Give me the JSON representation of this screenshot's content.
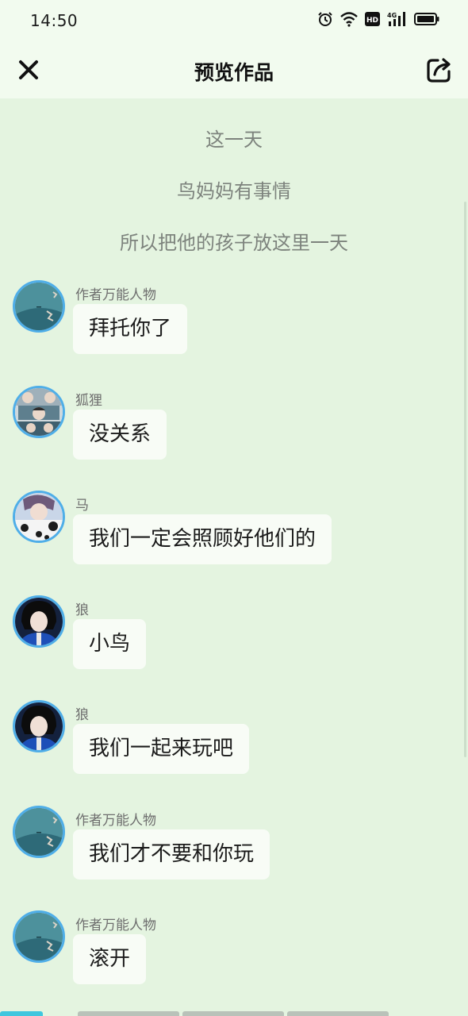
{
  "status": {
    "time": "14:50",
    "icons": [
      "alarm-icon",
      "wifi-icon",
      "hd-icon",
      "signal-4g-icon",
      "battery-icon"
    ],
    "hd_label": "HD",
    "network_label": "4G"
  },
  "nav": {
    "title": "预览作品",
    "close_icon": "close-icon",
    "share_icon": "share-icon"
  },
  "story": {
    "narration": [
      "这一天",
      "鸟妈妈有事情",
      "所以把他的孩子放这里一天"
    ],
    "messages": [
      {
        "sender": "作者万能人物",
        "text": "拜托你了",
        "avatar": "author-avatar"
      },
      {
        "sender": "狐狸",
        "text": "没关系",
        "avatar": "fox-avatar"
      },
      {
        "sender": "马",
        "text": "我们一定会照顾好他们的",
        "avatar": "horse-avatar"
      },
      {
        "sender": "狼",
        "text": "小鸟",
        "avatar": "wolf-avatar"
      },
      {
        "sender": "狼",
        "text": "我们一起来玩吧",
        "avatar": "wolf-avatar"
      },
      {
        "sender": "作者万能人物",
        "text": "我们才不要和你玩",
        "avatar": "author-avatar"
      },
      {
        "sender": "作者万能人物",
        "text": "滚开",
        "avatar": "author-avatar"
      }
    ]
  },
  "colors": {
    "background": "#e4f4e0",
    "header": "#f2fbef",
    "bubble": "#f8fcf6",
    "avatar_ring": "#4faee8",
    "narration_text": "#7d837d",
    "active_tab": "#3fc6de"
  }
}
